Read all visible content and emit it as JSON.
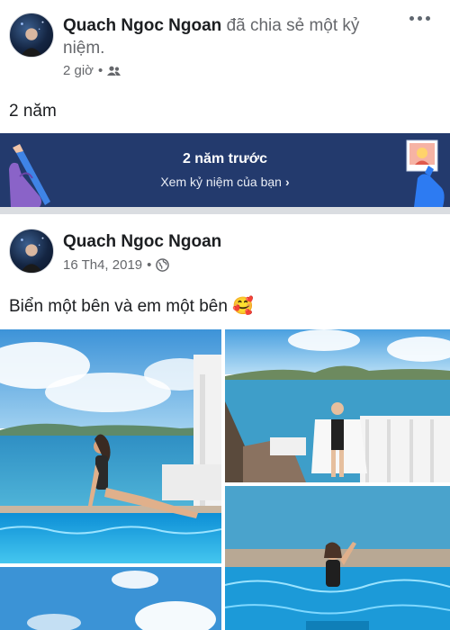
{
  "memory_post": {
    "author": "Quach Ngoc Ngoan",
    "action_line1": "đã chia sẻ một kỷ",
    "action_line2": "niệm.",
    "time": "2 giờ",
    "separator": "•",
    "audience_icon": "friends-icon",
    "text": "2 năm",
    "more_icon": "more-options-icon"
  },
  "memory_banner": {
    "title": "2 năm trước",
    "link": "Xem kỷ niệm của bạn",
    "chevron": "›",
    "colors": {
      "background": "#233a6d",
      "purple_hand": "#8a63c8",
      "blue_hand": "#2d7bf2"
    }
  },
  "original_post": {
    "author": "Quach Ngoc Ngoan",
    "date": "16 Th4, 2019",
    "separator": "•",
    "audience_icon": "globe-icon",
    "text": "Biển một bên và em một bên",
    "emoji": "🥰"
  },
  "photos": [
    "pool-photo-1",
    "terrace-photo",
    "pool-photo-2",
    "sky-photo"
  ]
}
